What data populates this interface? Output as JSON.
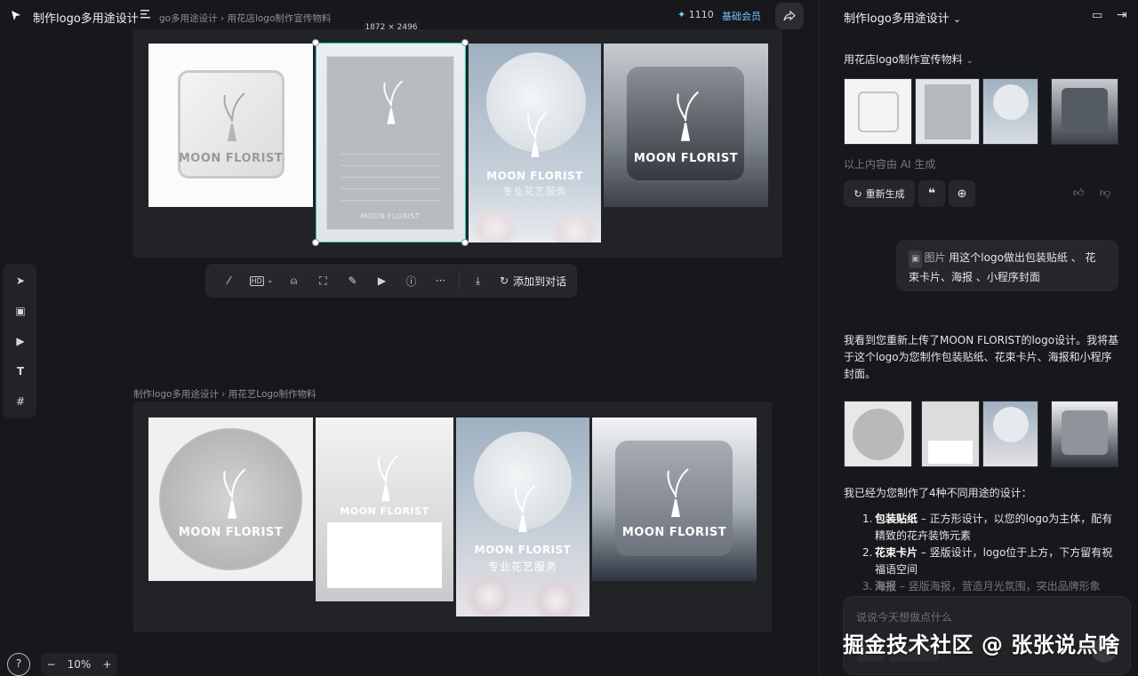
{
  "topbar": {
    "project_title": "制作logo多用途设计",
    "breadcrumb_1": "go多用途设计 › 用花店logo制作宣传物料",
    "credits": "1110",
    "member": "基础会员"
  },
  "canvas": {
    "selection_size": "1872 × 2496",
    "breadcrumb_2": "制作logo多用途设计 › 用花艺Logo制作物料",
    "brand": "MOON FLORIST",
    "brand_sub": "专业花艺服务",
    "zoom": "10%"
  },
  "float_toolbar": {
    "add_label": "添加到对话"
  },
  "panel": {
    "title": "制作logo多用途设计",
    "section_title": "用花店logo制作宣传物料",
    "ai_note": "以上内容由 AI 生成",
    "regen_label": "重新生成",
    "user_tag": "图片",
    "user_msg": "用这个logo做出包装贴纸 、 花束卡片、海报 、小程序封面",
    "reply_1": "我看到您重新上传了MOON FLORIST的logo设计。我将基于这个logo为您制作包装贴纸、花束卡片、海报和小程序封面。",
    "reply_2": "我已经为您制作了4种不同用途的设计：",
    "items": [
      {
        "num": "1.",
        "bold": "包装贴纸",
        "text": " – 正方形设计，以您的logo为主体，配有精致的花卉装饰元素"
      },
      {
        "num": "2.",
        "bold": "花束卡片",
        "text": " – 竖版设计，logo位于上方，下方留有祝福语空间"
      },
      {
        "num": "3.",
        "bold": "海报",
        "text": " – 竖版海报，营造月光氛围，突出品牌形象"
      }
    ],
    "input_placeholder": "说说今天想做点什么"
  },
  "watermark": "掘金技术社区 @ 张张说点啥"
}
